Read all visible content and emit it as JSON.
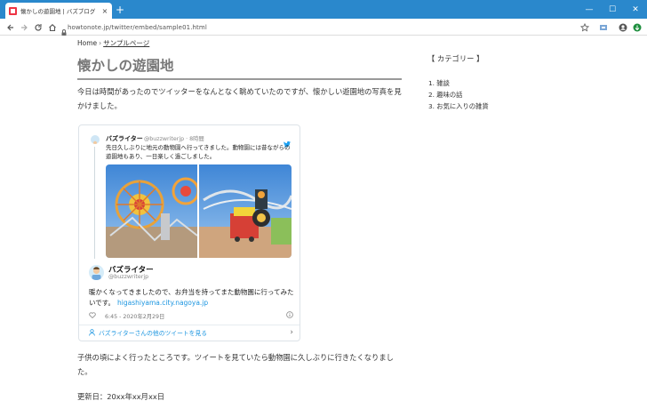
{
  "browser": {
    "tab_title": "懐かしの遊園地 | バズブログ",
    "tab_close": "×",
    "new_tab": "+",
    "url": "howtonote.jp/twitter/embed/sample01.html",
    "window_controls": {
      "minimize": "—",
      "maximize": "☐",
      "close": "✕"
    }
  },
  "breadcrumb": {
    "home": "Home",
    "separator": "›",
    "current": "サンプルページ"
  },
  "post": {
    "title": "懐かしの遊園地",
    "intro": "今日は時間があったのでツイッターをなんとなく眺めていたのですが、懐かしい遊園地の写真を見かけました。",
    "after": "子供の頃によく行ったところです。ツイートを見ていたら動物園に久しぶりに行きたくなりました。",
    "updated": "更新日：20xx年xx月xx日"
  },
  "embedded_tweet": {
    "quoted": {
      "name": "バズライター",
      "handle": "@buzzwriterjp",
      "time": "· 8時間",
      "text": "先日久しぶりに地元の動物園へ行ってきました。動物園には昔ながらの遊園地もあり、一日楽しく過ごしました。"
    },
    "name": "バズライター",
    "handle": "@buzzwriterjp",
    "text": "暖かくなってきましたので、お弁当を持ってまた動物園に行ってみたいです。",
    "link": "higashiyama.city.nagoya.jp",
    "timestamp": "6:45 - 2020年2月29日",
    "more": "バズライターさんの他のツイートを見る"
  },
  "sidebar": {
    "title": "【 カテゴリー 】",
    "items": [
      "1. 雑談",
      "2. 趣味の話",
      "3. お気に入りの雑貨"
    ]
  },
  "colors": {
    "titlebar": "#2a88cc",
    "twitter_blue": "#1b95e0"
  },
  "icons": [
    "back-icon",
    "forward-icon",
    "reload-icon",
    "home-icon",
    "lock-icon",
    "star-icon",
    "account-icon",
    "extension-icon",
    "twitter-bird-icon",
    "heart-icon",
    "info-icon",
    "person-icon",
    "chevron-right-icon"
  ]
}
